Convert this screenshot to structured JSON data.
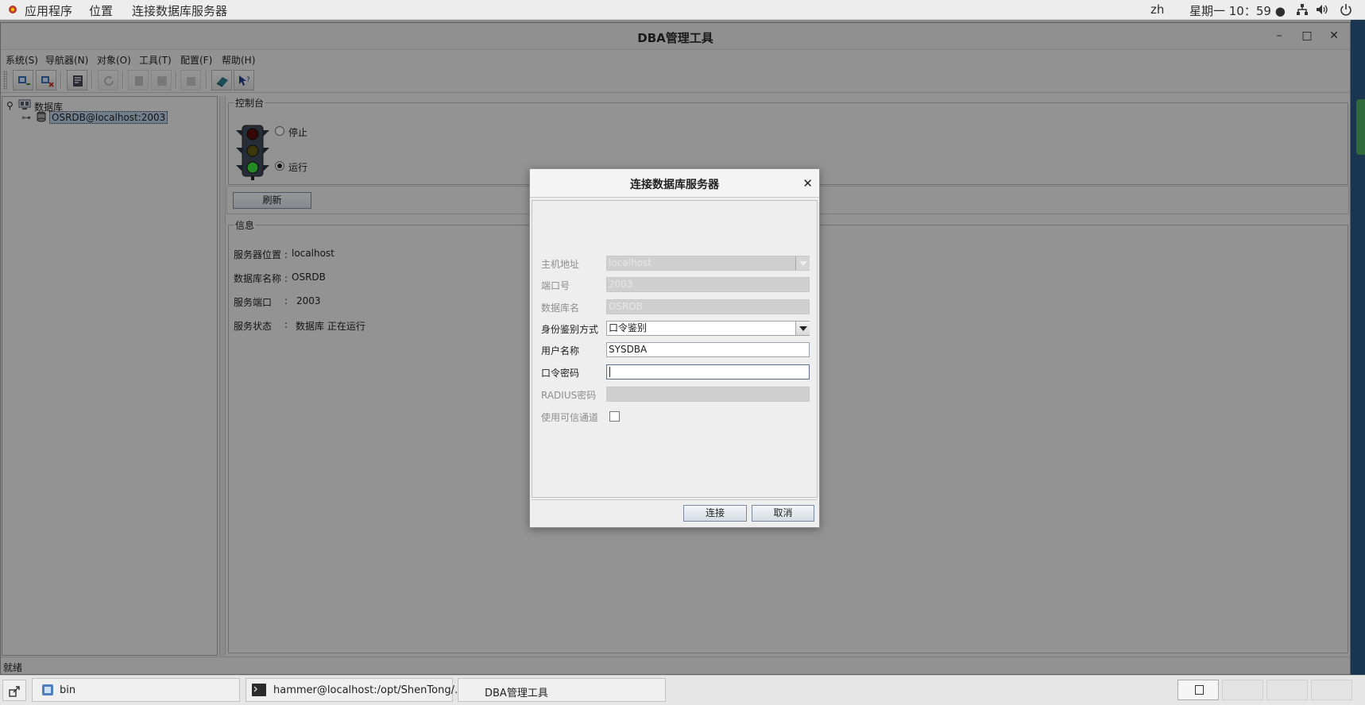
{
  "topbar": {
    "apps": "应用程序",
    "places": "位置",
    "active_app": "连接数据库服务器",
    "lang": "zh",
    "clock": "星期一 10：59 ●"
  },
  "window": {
    "title": "DBA管理工具",
    "controls": {
      "minimize": "–",
      "maximize": "□",
      "close": "✕"
    }
  },
  "menubar": [
    "系统(S)",
    "导航器(N)",
    "对象(O)",
    "工具(T)",
    "配置(F)",
    "帮助(H)"
  ],
  "toolbar": {
    "icons": [
      "connect-server-icon",
      "disconnect-server-icon",
      "console-icon",
      "refresh-icon",
      "backup-icon",
      "restore-icon",
      "export-icon",
      "manual-icon",
      "help-cursor-icon"
    ]
  },
  "tree": {
    "root": "数据库",
    "child": "OSRDB@localhost:2003"
  },
  "console": {
    "title": "控制台",
    "stop_label": "停止",
    "run_label": "运行",
    "refresh_button": "刷新"
  },
  "info": {
    "title": "信息",
    "rows": [
      {
        "label": "服务器位置 :",
        "value": "localhost"
      },
      {
        "label": "数据库名称 :",
        "value": "OSRDB"
      },
      {
        "label": "服务端口",
        "sep": ":",
        "value": "2003"
      },
      {
        "label": "服务状态",
        "sep": ":",
        "value": "数据库 正在运行"
      }
    ]
  },
  "status": "就绪",
  "dialog": {
    "title": "连接数据库服务器",
    "fields": {
      "host_label": "主机地址",
      "host_value": "localhost",
      "port_label": "端口号",
      "port_value": "2003",
      "dbname_label": "数据库名",
      "dbname_value": "OSRDB",
      "auth_label": "身份鉴别方式",
      "auth_value": "口令鉴别",
      "user_label": "用户名称",
      "user_value": "SYSDBA",
      "password_label": "口令密码",
      "password_value": "",
      "radius_label": "RADIUS密码",
      "trusted_label": "使用可信通道"
    },
    "connect_button": "连接",
    "cancel_button": "取消"
  },
  "taskbar": {
    "tasks": [
      "bin",
      "hammer@localhost:/opt/ShenTong/…",
      "DBA管理工具"
    ]
  }
}
